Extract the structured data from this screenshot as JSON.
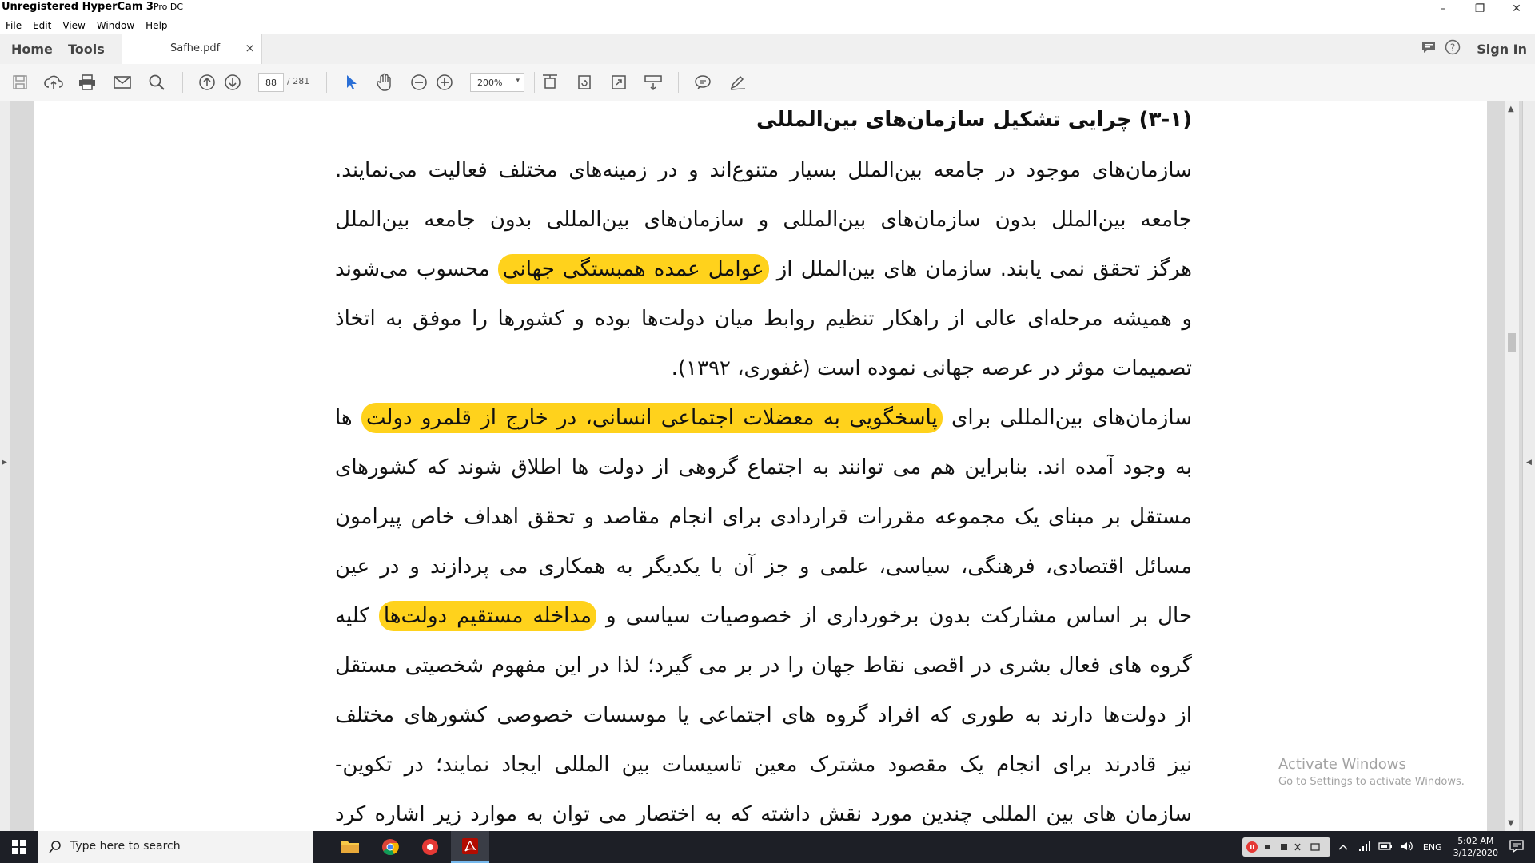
{
  "window": {
    "title": "Unregistered HyperCam 3",
    "title_suffix": "Pro DC",
    "controls": {
      "minimize": "–",
      "restore": "❐",
      "close": "✕"
    }
  },
  "menu": [
    "File",
    "Edit",
    "View",
    "Window",
    "Help"
  ],
  "tabs": {
    "home": "Home",
    "tools": "Tools",
    "document": "Safhe.pdf",
    "close": "×",
    "sign_in": "Sign In"
  },
  "toolbar": {
    "page_current": "88",
    "page_total": "/ 281",
    "zoom": "200%",
    "zoom_arrow": "▾"
  },
  "document": {
    "heading": "(۳-۱) چرایی تشکیل سازمان‌های بین‌المللی",
    "lines": [
      "سازمان‌های موجود در جامعه بین‌الملل بسیار متنوع‌اند و در زمینه‌های مختلف فعالیت می‌نمایند.",
      "جامعه بین‌الملل بدون سازمان‌های بین‌المللی و سازمان‌های بین‌المللی بدون جامعه بین‌الملل",
      "و همیشه مرحله‌ای عالی از راهکار تنظیم روابط میان دولت‌ها بوده و کشورها را موفق به اتخاذ",
      "تصمیمات موثر در عرصه جهانی نموده است (غفوری، ۱۳۹۲).",
      "به وجود آمده اند. بنابراین هم می توانند به اجتماع گروهی از دولت ها اطلاق شوند که کشورهای",
      "مستقل بر مبنای یک مجموعه مقررات قراردادی برای انجام مقاصد و تحقق اهداف خاص پیرامون",
      "مسائل اقتصادی، فرهنگی، سیاسی، علمی و جز آن با یکدیگر به همکاری می پردازند و در عین",
      "گروه های فعال بشری در اقصی نقاط جهان را در بر می گیرد؛ لذا در این مفهوم شخصیتی مستقل",
      "از دولت‌ها دارند به طوری که افراد گروه های اجتماعی یا موسسات خصوصی کشورهای مختلف",
      "نیز قادرند برای انجام یک مقصود مشترک معین تاسیسات بین المللی ایجاد نمایند؛ در تکوین-",
      "سازمان های بین المللی چندین مورد نقش داشته که به اختصار می توان به موارد زیر اشاره کرد"
    ],
    "line3_a": "هرگز تحقق نمی یابند. سازمان های بین‌الملل از",
    "line3_hl": "عوامل عمده همبستگی جهانی",
    "line3_b": "محسوب می‌شوند",
    "line7_a": "سازمان‌های بین‌المللی برای",
    "line7_hl": "پاسخگویی به معضلات اجتماعی انسانی، در خارج از قلمرو دولت",
    "line7_b": "ها",
    "line11_a": "حال بر اساس مشارکت بدون برخورداری از خصوصیات سیاسی و",
    "line11_hl": "مداخله مستقیم دولت‌ها",
    "line11_b": "کلیه",
    "highlight_color": "#ffd21c"
  },
  "watermark": {
    "title": "Activate Windows",
    "subtitle": "Go to Settings to activate Windows."
  },
  "taskbar": {
    "search_placeholder": "Type here to search",
    "language": "ENG",
    "time": "5:02 AM",
    "date": "3/12/2020"
  }
}
